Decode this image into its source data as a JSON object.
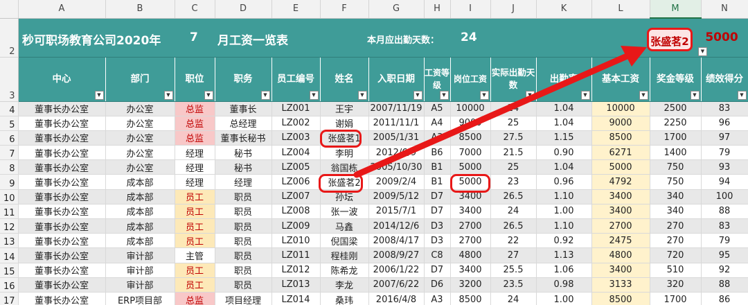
{
  "spreadsheet": {
    "column_letters": [
      "A",
      "B",
      "C",
      "D",
      "E",
      "F",
      "G",
      "H",
      "I",
      "J",
      "K",
      "L",
      "M",
      "N"
    ],
    "selected_column": "M",
    "title_row": {
      "row_number": "2",
      "company_title": "秒可职场教育公司2020年",
      "month": "7",
      "month_suffix": "月工资一览表",
      "days_label": "本月应出勤天数：",
      "days_value": "24",
      "lookup_name": "张盛茗2",
      "lookup_value": "5000"
    },
    "header_row": {
      "row_number": "3",
      "headers": [
        "中心",
        "部门",
        "职位",
        "职务",
        "员工编号",
        "姓名",
        "入职日期",
        "工资等级",
        "岗位工资",
        "实际出勤天数",
        "出勤率",
        "基本工资",
        "奖金等级",
        "绩效得分"
      ]
    },
    "rows": [
      {
        "n": "4",
        "center": "董事长办公室",
        "dept": "办公室",
        "pos": "总监",
        "duty": "董事长",
        "id": "LZ001",
        "name": "王宇",
        "date": "2007/11/19",
        "grade": "A5",
        "post_wage": "10000",
        "days": "24",
        "rate": "1.04",
        "basic": "10000",
        "bonus": "2500",
        "score": "83"
      },
      {
        "n": "5",
        "center": "董事长办公室",
        "dept": "办公室",
        "pos": "总监",
        "duty": "总经理",
        "id": "LZ002",
        "name": "谢娟",
        "date": "2011/11/1",
        "grade": "A4",
        "post_wage": "9000",
        "days": "25",
        "rate": "1.04",
        "basic": "9000",
        "bonus": "2250",
        "score": "96"
      },
      {
        "n": "6",
        "center": "董事长办公室",
        "dept": "办公室",
        "pos": "总监",
        "duty": "董事长秘书",
        "id": "LZ003",
        "name": "张盛茗1",
        "date": "2005/1/31",
        "grade": "A3",
        "post_wage": "8500",
        "days": "27.5",
        "rate": "1.15",
        "basic": "8500",
        "bonus": "1700",
        "score": "97"
      },
      {
        "n": "7",
        "center": "董事长办公室",
        "dept": "办公室",
        "pos": "经理",
        "duty": "秘书",
        "id": "LZ004",
        "name": "李明",
        "date": "2012/6/9",
        "grade": "B6",
        "post_wage": "7000",
        "days": "21.5",
        "rate": "0.90",
        "basic": "6271",
        "bonus": "1400",
        "score": "79"
      },
      {
        "n": "8",
        "center": "董事长办公室",
        "dept": "办公室",
        "pos": "经理",
        "duty": "秘书",
        "id": "LZ005",
        "name": "翁国栋",
        "date": "2005/10/30",
        "grade": "B1",
        "post_wage": "5000",
        "days": "25",
        "rate": "1.04",
        "basic": "5000",
        "bonus": "750",
        "score": "93"
      },
      {
        "n": "9",
        "center": "董事长办公室",
        "dept": "成本部",
        "pos": "经理",
        "duty": "经理",
        "id": "LZ006",
        "name": "张盛茗2",
        "date": "2009/2/4",
        "grade": "B1",
        "post_wage": "5000",
        "days": "23",
        "rate": "0.96",
        "basic": "4792",
        "bonus": "750",
        "score": "94"
      },
      {
        "n": "10",
        "center": "董事长办公室",
        "dept": "成本部",
        "pos": "员工",
        "duty": "职员",
        "id": "LZ007",
        "name": "孙坛",
        "date": "2009/5/12",
        "grade": "D7",
        "post_wage": "3400",
        "days": "26.5",
        "rate": "1.10",
        "basic": "3400",
        "bonus": "340",
        "score": "100"
      },
      {
        "n": "11",
        "center": "董事长办公室",
        "dept": "成本部",
        "pos": "员工",
        "duty": "职员",
        "id": "LZ008",
        "name": "张一波",
        "date": "2015/7/1",
        "grade": "D7",
        "post_wage": "3400",
        "days": "24",
        "rate": "1.00",
        "basic": "3400",
        "bonus": "340",
        "score": "88"
      },
      {
        "n": "12",
        "center": "董事长办公室",
        "dept": "成本部",
        "pos": "员工",
        "duty": "职员",
        "id": "LZ009",
        "name": "马鑫",
        "date": "2014/12/6",
        "grade": "D3",
        "post_wage": "2700",
        "days": "26.5",
        "rate": "1.10",
        "basic": "2700",
        "bonus": "270",
        "score": "83"
      },
      {
        "n": "13",
        "center": "董事长办公室",
        "dept": "成本部",
        "pos": "员工",
        "duty": "职员",
        "id": "LZ010",
        "name": "倪国梁",
        "date": "2008/4/17",
        "grade": "D3",
        "post_wage": "2700",
        "days": "22",
        "rate": "0.92",
        "basic": "2475",
        "bonus": "270",
        "score": "79"
      },
      {
        "n": "14",
        "center": "董事长办公室",
        "dept": "审计部",
        "pos": "主管",
        "duty": "职员",
        "id": "LZ011",
        "name": "程桂刚",
        "date": "2008/9/27",
        "grade": "C8",
        "post_wage": "4800",
        "days": "27",
        "rate": "1.13",
        "basic": "4800",
        "bonus": "720",
        "score": "95"
      },
      {
        "n": "15",
        "center": "董事长办公室",
        "dept": "审计部",
        "pos": "员工",
        "duty": "职员",
        "id": "LZ012",
        "name": "陈希龙",
        "date": "2006/1/22",
        "grade": "D7",
        "post_wage": "3400",
        "days": "25.5",
        "rate": "1.06",
        "basic": "3400",
        "bonus": "510",
        "score": "92"
      },
      {
        "n": "16",
        "center": "董事长办公室",
        "dept": "审计部",
        "pos": "员工",
        "duty": "职员",
        "id": "LZ013",
        "name": "李龙",
        "date": "2007/6/22",
        "grade": "D6",
        "post_wage": "3200",
        "days": "23.5",
        "rate": "0.98",
        "basic": "3133",
        "bonus": "320",
        "score": "88"
      },
      {
        "n": "17",
        "center": "董事长办公室",
        "dept": "ERP项目部",
        "pos": "总监",
        "duty": "项目经理",
        "id": "LZ014",
        "name": "桑玮",
        "date": "2016/4/8",
        "grade": "A3",
        "post_wage": "8500",
        "days": "24",
        "rate": "1.00",
        "basic": "8500",
        "bonus": "1700",
        "score": "86"
      }
    ]
  },
  "colors": {
    "header_teal": "#3f9c98",
    "highlight_red": "#e81818",
    "director_fill": "#f8c8c8",
    "staff_fill": "#fde9b8",
    "basic_wage_fill": "#fff2cc"
  },
  "icons": {
    "filter_dropdown": "filter-dropdown-icon",
    "annotation": "red-arrow-annotation"
  }
}
